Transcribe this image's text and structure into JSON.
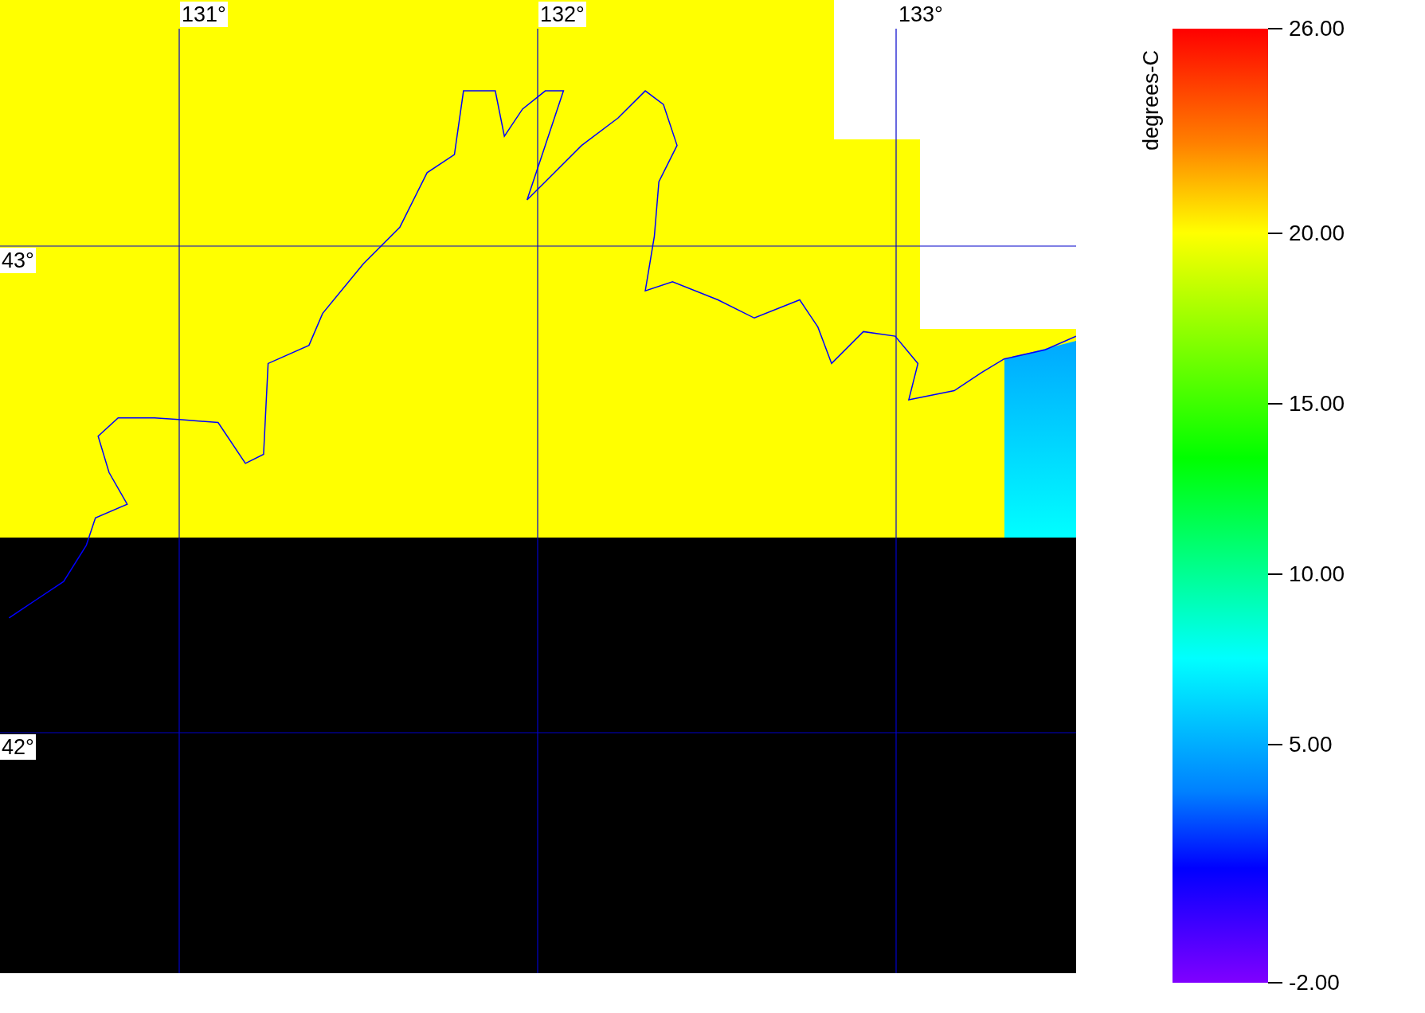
{
  "map": {
    "longitude_labels": [
      "131°",
      "132°",
      "133°"
    ],
    "latitude_labels": [
      "43°",
      "42°"
    ]
  },
  "colorbar": {
    "units": "degrees-C",
    "ticks": [
      "26.00",
      "20.00",
      "15.00",
      "10.00",
      "5.00",
      "-2.00"
    ]
  }
}
